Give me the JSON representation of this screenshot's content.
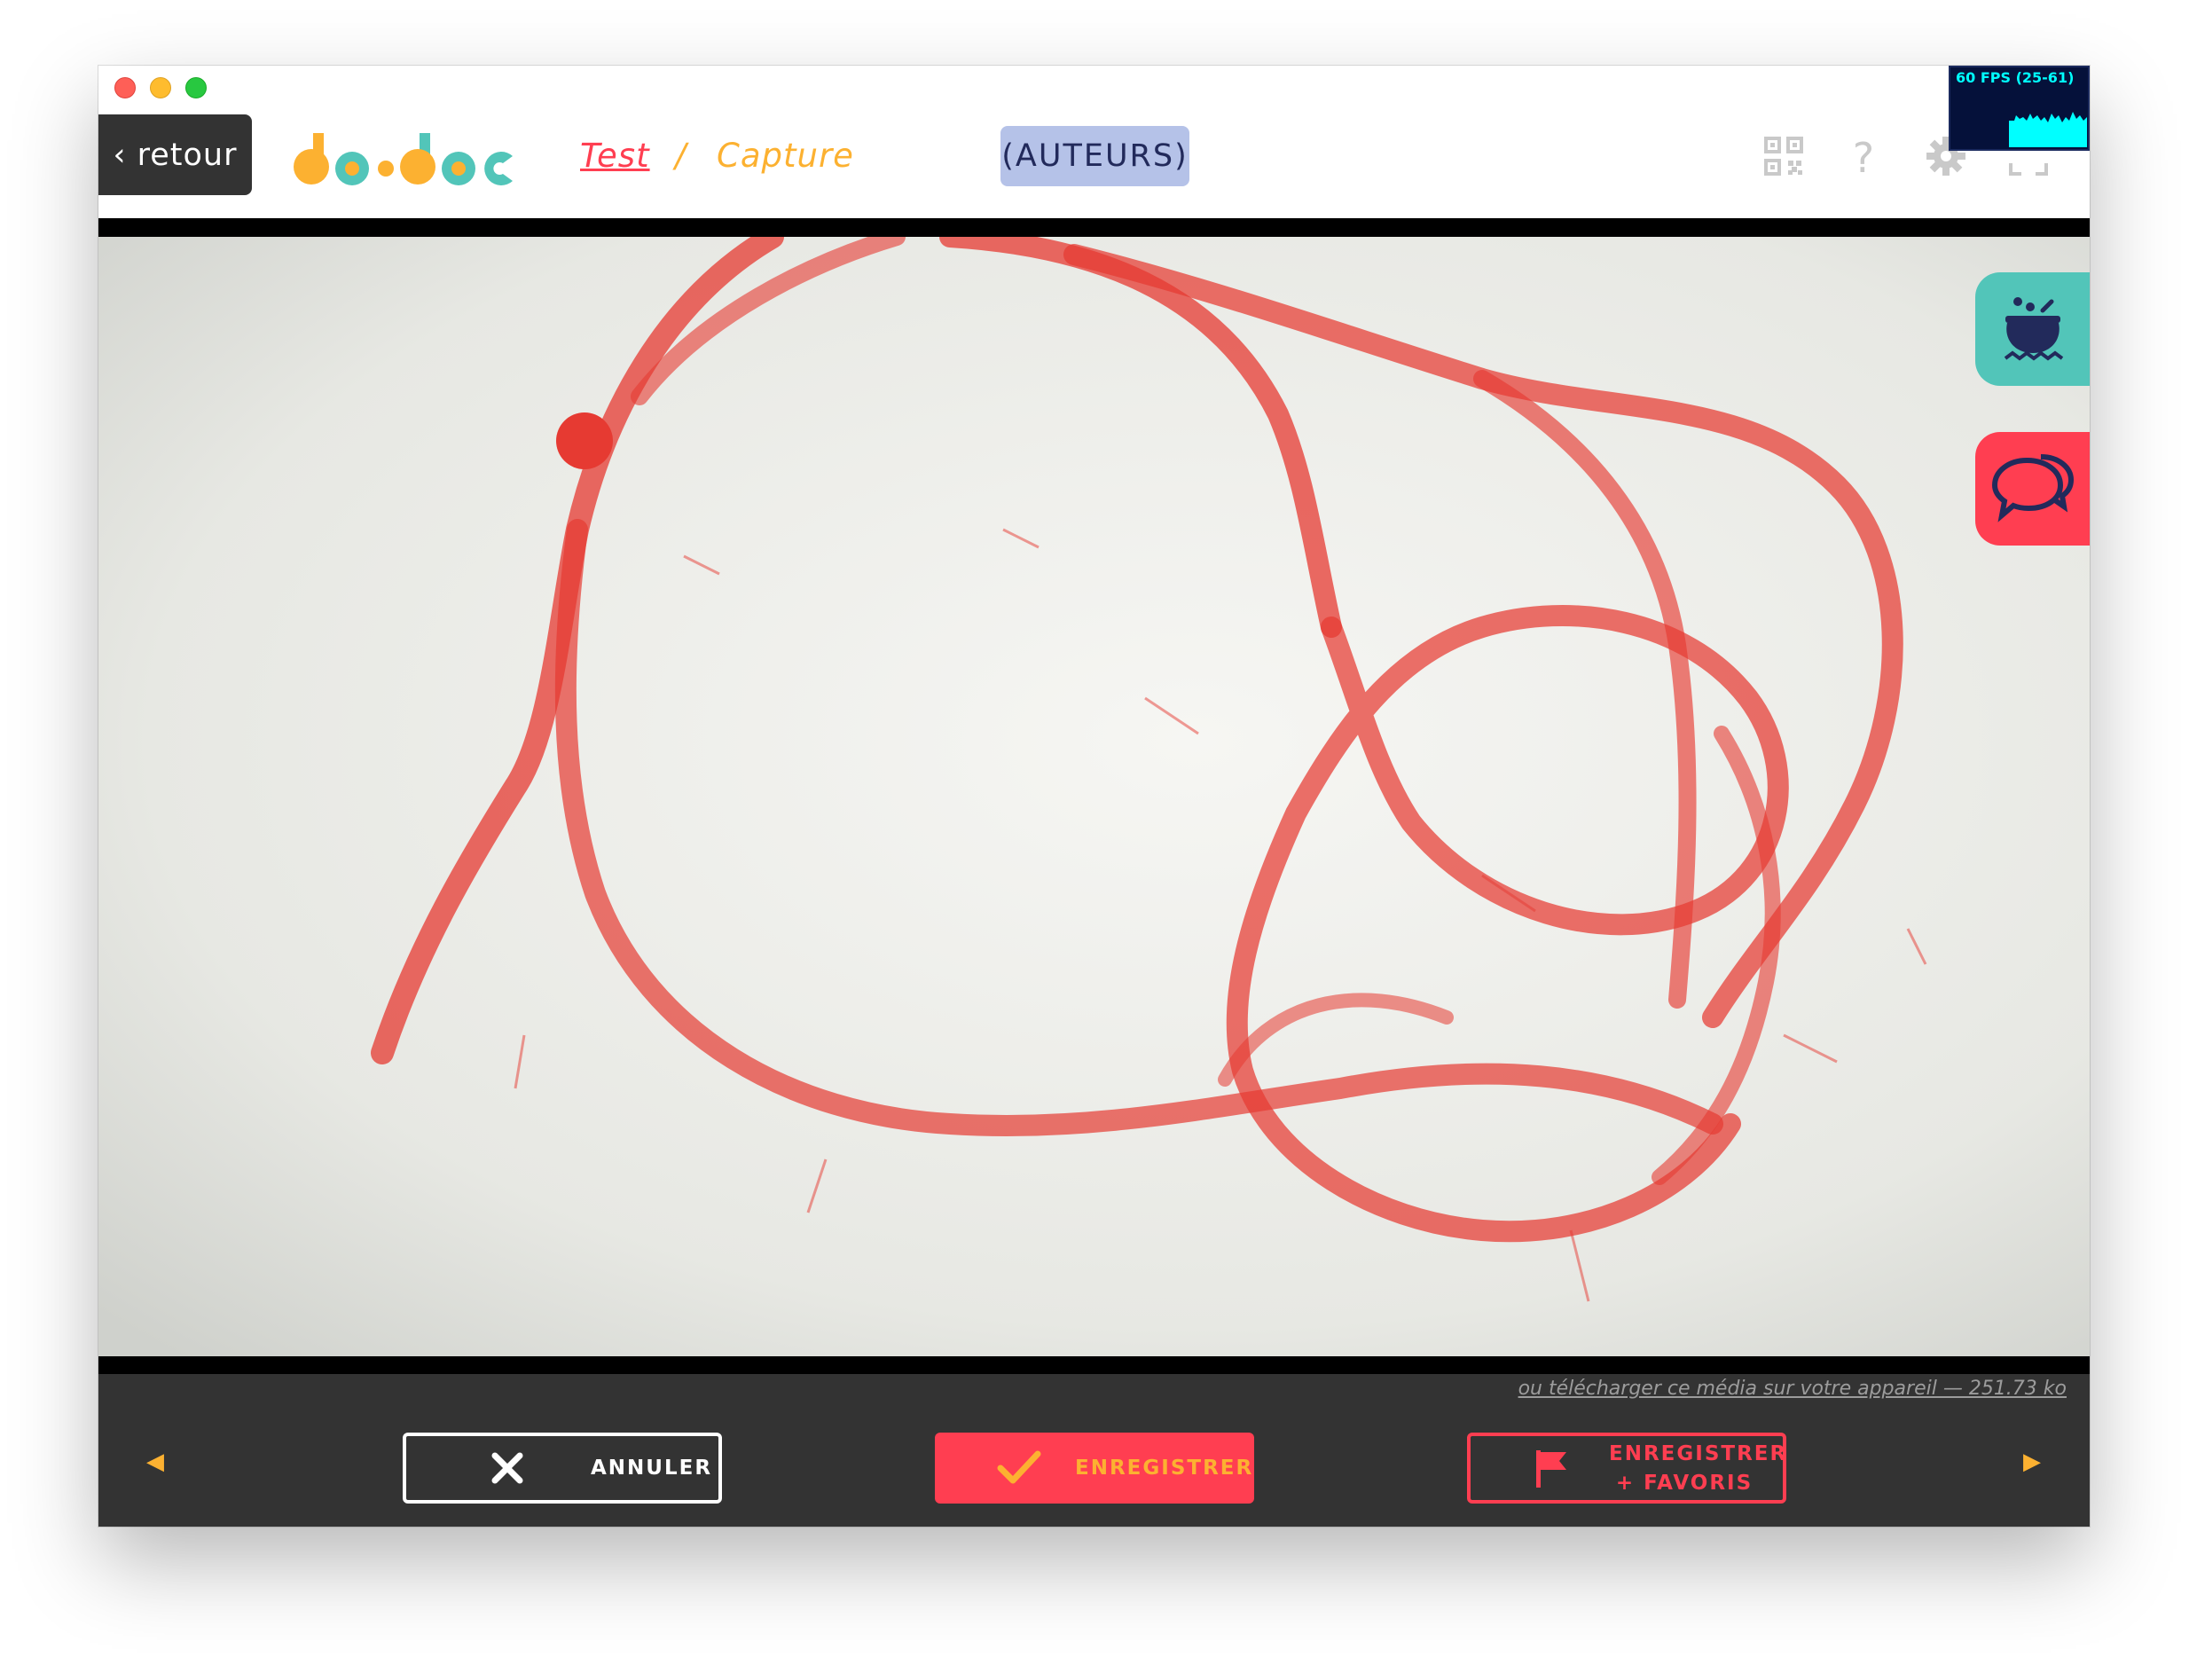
{
  "window": {
    "controls": [
      "close",
      "minimize",
      "zoom"
    ]
  },
  "header": {
    "back_label": "‹ retour",
    "logo_alt": "do•doc",
    "breadcrumb": {
      "project": "Test",
      "separator": "/",
      "page": "Capture"
    },
    "authors_label": "(AUTEURS)",
    "icons": [
      "qr-code-icon",
      "help-icon",
      "settings-icon",
      "fullscreen-icon"
    ]
  },
  "fps_meter": {
    "label": "60 FPS (25-61)"
  },
  "side_tabs": [
    {
      "name": "recipe-cauldron-icon",
      "color": "#52c5b9"
    },
    {
      "name": "chat-bubbles-icon",
      "color": "#ff3e51"
    }
  ],
  "capture": {
    "description": "photo preview"
  },
  "footer": {
    "download_link": "ou télécharger ce média sur votre appareil — 251.73 ko",
    "prev_arrow": "◀",
    "next_arrow": "▶",
    "cancel_label": "ANNULER",
    "save_label": "ENREGISTRER",
    "save_fav_line1": "ENREGISTRER",
    "save_fav_line2": "+ FAVORIS"
  },
  "colors": {
    "accent_red": "#ff3e51",
    "accent_yellow": "#fcb131",
    "accent_teal": "#52c5b9",
    "authors_bg": "#b5c2e8",
    "dark_bar": "#333333"
  }
}
